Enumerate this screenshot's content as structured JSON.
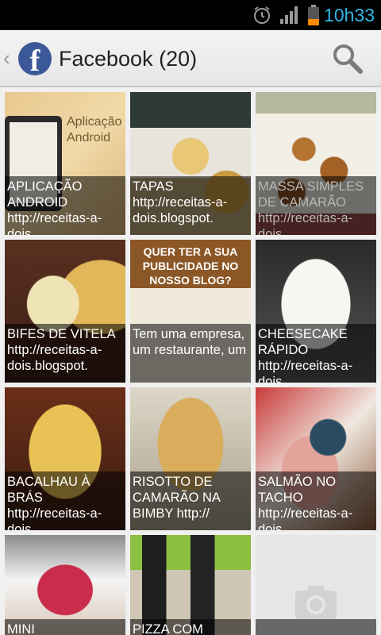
{
  "status_bar": {
    "time": "10h33",
    "icons": [
      "alarm-icon",
      "signal-icon",
      "battery-icon"
    ]
  },
  "action_bar": {
    "up_caret": "‹",
    "logo_letter": "f",
    "title": "Facebook (20)",
    "search_icon": "search-icon"
  },
  "colors": {
    "time_blue": "#33b5e5",
    "facebook_blue": "#3b5998"
  },
  "tiles": [
    {
      "caption": "APLICAÇÃO ANDROID http://receitas-a-dois.",
      "photo_text": "Aplicação Android"
    },
    {
      "caption": "TAPAS http://receitas-a-dois.blogspot."
    },
    {
      "caption": "MASSA SIMPLES DE CAMARÃO http://receitas-a-dois."
    },
    {
      "caption": "BIFES DE VITELA http://receitas-a-dois.blogspot."
    },
    {
      "caption": "Tem uma empresa, um restaurante, um",
      "photo_text": "QUER TER A SUA PUBLICIDADE NO NOSSO BLOG?"
    },
    {
      "caption": "CHEESECAKE RÁPIDO http://receitas-a-dois."
    },
    {
      "caption": "BACALHAU À BRÁS http://receitas-a-dois."
    },
    {
      "caption": "RISOTTO DE CAMARÃO NA BIMBY http://"
    },
    {
      "caption": "SALMÃO NO TACHO http://receitas-a-dois."
    },
    {
      "caption": "MINI"
    },
    {
      "caption": "PIZZA COM"
    },
    {
      "caption": ""
    }
  ]
}
